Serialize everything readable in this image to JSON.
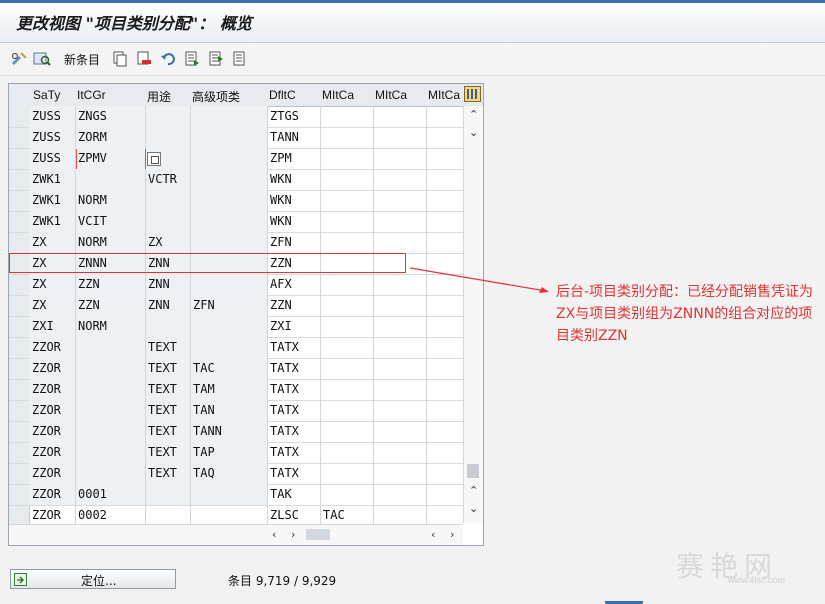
{
  "window": {
    "title": "更改视图 \"项目类别分配\"： 概览"
  },
  "toolbar": {
    "new_entries_label": "新条目"
  },
  "table": {
    "columns": [
      "SaTy",
      "ItCGr",
      "用途",
      "高级项类",
      "DfltC",
      "MItCa",
      "MItCa",
      "MItCa"
    ],
    "rows": [
      [
        "ZUSS",
        "ZNGS",
        "",
        "",
        "ZTGS",
        "",
        "",
        ""
      ],
      [
        "ZUSS",
        "ZORM",
        "",
        "",
        "TANN",
        "",
        "",
        ""
      ],
      [
        "ZUSS",
        "ZPMV",
        "",
        "",
        "ZPM",
        "",
        "",
        ""
      ],
      [
        "ZWK1",
        "",
        "VCTR",
        "",
        "WKN",
        "",
        "",
        ""
      ],
      [
        "ZWK1",
        "NORM",
        "",
        "",
        "WKN",
        "",
        "",
        ""
      ],
      [
        "ZWK1",
        "VCIT",
        "",
        "",
        "WKN",
        "",
        "",
        ""
      ],
      [
        "ZX",
        "NORM",
        "ZX",
        "",
        "ZFN",
        "",
        "",
        ""
      ],
      [
        "ZX",
        "ZNNN",
        "ZNN",
        "",
        "ZZN",
        "",
        "",
        ""
      ],
      [
        "ZX",
        "ZZN",
        "ZNN",
        "",
        "AFX",
        "",
        "",
        ""
      ],
      [
        "ZX",
        "ZZN",
        "ZNN",
        "ZFN",
        "ZZN",
        "",
        "",
        ""
      ],
      [
        "ZXI",
        "NORM",
        "",
        "",
        "ZXI",
        "",
        "",
        ""
      ],
      [
        "ZZOR",
        "",
        "TEXT",
        "",
        "TATX",
        "",
        "",
        ""
      ],
      [
        "ZZOR",
        "",
        "TEXT",
        "TAC",
        "TATX",
        "",
        "",
        ""
      ],
      [
        "ZZOR",
        "",
        "TEXT",
        "TAM",
        "TATX",
        "",
        "",
        ""
      ],
      [
        "ZZOR",
        "",
        "TEXT",
        "TAN",
        "TATX",
        "",
        "",
        ""
      ],
      [
        "ZZOR",
        "",
        "TEXT",
        "TANN",
        "TATX",
        "",
        "",
        ""
      ],
      [
        "ZZOR",
        "",
        "TEXT",
        "TAP",
        "TATX",
        "",
        "",
        ""
      ],
      [
        "ZZOR",
        "",
        "TEXT",
        "TAQ",
        "TATX",
        "",
        "",
        ""
      ],
      [
        "ZZOR",
        "0001",
        "",
        "",
        "TAK",
        "",
        "",
        ""
      ],
      [
        "ZZOR",
        "0002",
        "",
        "",
        "ZLSC",
        "TAC",
        "",
        ""
      ]
    ]
  },
  "annotation": {
    "text": "后台-项目类别分配：已经分配销售凭证为ZX与项目类别组为ZNNN的组合对应的项目类别ZZN"
  },
  "footer": {
    "position_button_label": "定位...",
    "entry_count": "条目 9,719 / 9,929"
  },
  "watermark": {
    "text": "赛艳网",
    "subtext": "www.4lsc.com"
  }
}
